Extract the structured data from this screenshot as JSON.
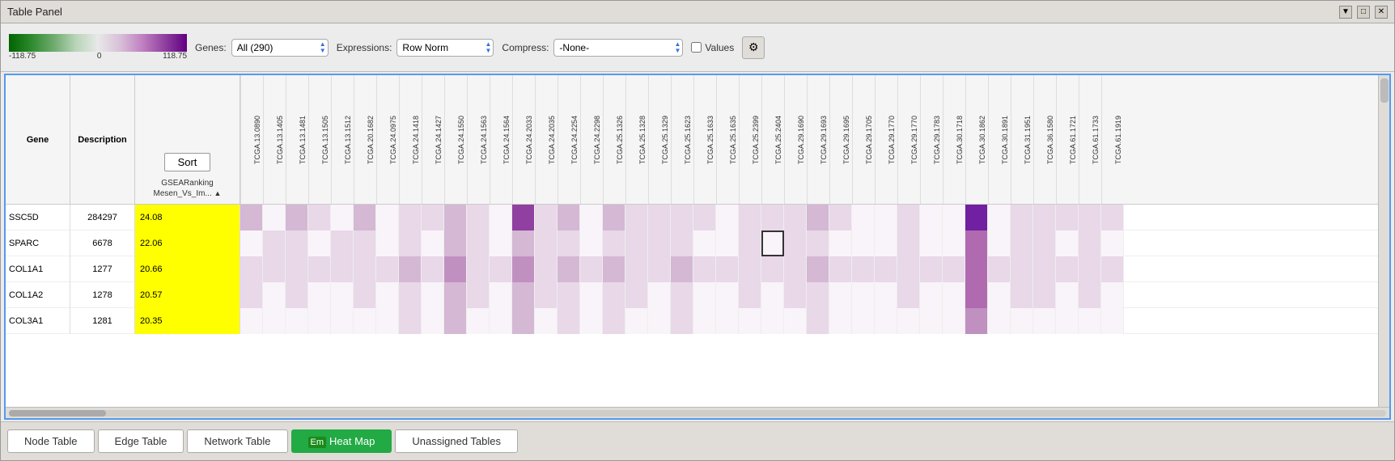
{
  "window": {
    "title": "Table Panel"
  },
  "toolbar": {
    "genes_label": "Genes:",
    "genes_value": "All (290)",
    "expressions_label": "Expressions:",
    "expressions_value": "Row Norm",
    "compress_label": "Compress:",
    "compress_value": "-None-",
    "values_label": "Values",
    "colormap": {
      "min": "-118.75",
      "mid": "0",
      "max": "118.75"
    }
  },
  "table": {
    "headers": {
      "gene": "Gene",
      "description": "Description",
      "sort_button": "Sort",
      "sort_label": "GSEARanking\nMesen_Vs_Im..."
    },
    "columns": [
      "TCGA.13.0890",
      "TCGA.13.1405",
      "TCGA.13.1481",
      "TCGA.13.1505",
      "TCGA.13.1512",
      "TCGA.20.1682",
      "TCGA.24.0975",
      "TCGA.24.1418",
      "TCGA.24.1427",
      "TCGA.24.1550",
      "TCGA.24.1563",
      "TCGA.24.1564",
      "TCGA.24.2033",
      "TCGA.24.2035",
      "TCGA.24.2254",
      "TCGA.24.2298",
      "TCGA.25.1326",
      "TCGA.25.1328",
      "TCGA.25.1329",
      "TCGA.25.1623",
      "TCGA.25.1633",
      "TCGA.25.1635",
      "TCGA.25.2399",
      "TCGA.25.2404",
      "TCGA.29.1690",
      "TCGA.29.1693",
      "TCGA.29.1695",
      "TCGA.29.1705",
      "TCGA.29.1770",
      "TCGA.29.1770",
      "TCGA.29.1783",
      "TCGA.30.1718",
      "TCGA.30.1862",
      "TCGA.30.1891",
      "TCGA.31.1951",
      "TCGA.36.1580",
      "TCGA.61.1721",
      "TCGA.61.1733",
      "TCGA.61.1919"
    ],
    "rows": [
      {
        "gene": "SSC5D",
        "description": "284297",
        "sort_value": "24.08",
        "heat": [
          0.1,
          0.05,
          0.1,
          0.08,
          0.05,
          0.1,
          0.05,
          0.08,
          0.06,
          0.12,
          0.08,
          0.05,
          0.3,
          0.08,
          0.1,
          0.05,
          0.12,
          0.08,
          0.06,
          0.08,
          0.06,
          0.05,
          0.08,
          0.06,
          0.08,
          0.1,
          0.06,
          0.05,
          0.05,
          0.08,
          0.05,
          0.05,
          0.4,
          0.05,
          0.08,
          0.08,
          0.06,
          0.08,
          0.06
        ]
      },
      {
        "gene": "SPARC",
        "description": "6678",
        "sort_value": "22.06",
        "heat": [
          0.05,
          0.08,
          0.06,
          0.05,
          0.08,
          0.06,
          0.05,
          0.06,
          0.05,
          0.1,
          0.06,
          0.05,
          0.12,
          0.06,
          0.08,
          0.05,
          0.08,
          0.06,
          0.06,
          0.06,
          0.05,
          0.05,
          0.06,
          0.05,
          0.06,
          0.08,
          0.05,
          0.05,
          0.05,
          0.06,
          0.05,
          0.05,
          0.2,
          0.05,
          0.06,
          0.06,
          0.05,
          0.06,
          0.05
        ],
        "selected_col": 23
      },
      {
        "gene": "COL1A1",
        "description": "1277",
        "sort_value": "20.66",
        "heat": [
          0.08,
          0.06,
          0.08,
          0.06,
          0.06,
          0.08,
          0.06,
          0.1,
          0.06,
          0.14,
          0.08,
          0.06,
          0.15,
          0.08,
          0.1,
          0.06,
          0.1,
          0.08,
          0.06,
          0.1,
          0.06,
          0.06,
          0.08,
          0.06,
          0.08,
          0.1,
          0.06,
          0.06,
          0.06,
          0.08,
          0.06,
          0.06,
          0.25,
          0.06,
          0.08,
          0.08,
          0.06,
          0.08,
          0.06
        ]
      },
      {
        "gene": "COL1A2",
        "description": "1278",
        "sort_value": "20.57",
        "heat": [
          0.06,
          0.05,
          0.06,
          0.05,
          0.05,
          0.06,
          0.05,
          0.08,
          0.05,
          0.12,
          0.06,
          0.05,
          0.12,
          0.06,
          0.08,
          0.05,
          0.08,
          0.06,
          0.05,
          0.08,
          0.05,
          0.05,
          0.06,
          0.05,
          0.06,
          0.08,
          0.05,
          0.05,
          0.05,
          0.06,
          0.05,
          0.05,
          0.18,
          0.05,
          0.06,
          0.06,
          0.05,
          0.06,
          0.05
        ]
      },
      {
        "gene": "COL3A1",
        "description": "1281",
        "sort_value": "20.35",
        "heat": [
          0.05,
          0.05,
          0.05,
          0.05,
          0.05,
          0.05,
          0.05,
          0.06,
          0.05,
          0.1,
          0.05,
          0.05,
          0.1,
          0.05,
          0.06,
          0.05,
          0.06,
          0.05,
          0.05,
          0.06,
          0.05,
          0.05,
          0.05,
          0.05,
          0.05,
          0.06,
          0.05,
          0.05,
          0.05,
          0.05,
          0.05,
          0.05,
          0.15,
          0.05,
          0.05,
          0.05,
          0.05,
          0.05,
          0.05
        ]
      }
    ]
  },
  "tabs": {
    "items": [
      {
        "label": "Node Table",
        "active": false
      },
      {
        "label": "Edge Table",
        "active": false
      },
      {
        "label": "Network Table",
        "active": false
      },
      {
        "label": "Heat Map",
        "active": true,
        "icon": "Em"
      },
      {
        "label": "Unassigned Tables",
        "active": false
      }
    ]
  },
  "icons": {
    "dropdown_arrow": "▼",
    "sort_arrow": "▲",
    "gear": "⚙",
    "minimize": "▼",
    "restore": "□",
    "close": "✕"
  }
}
